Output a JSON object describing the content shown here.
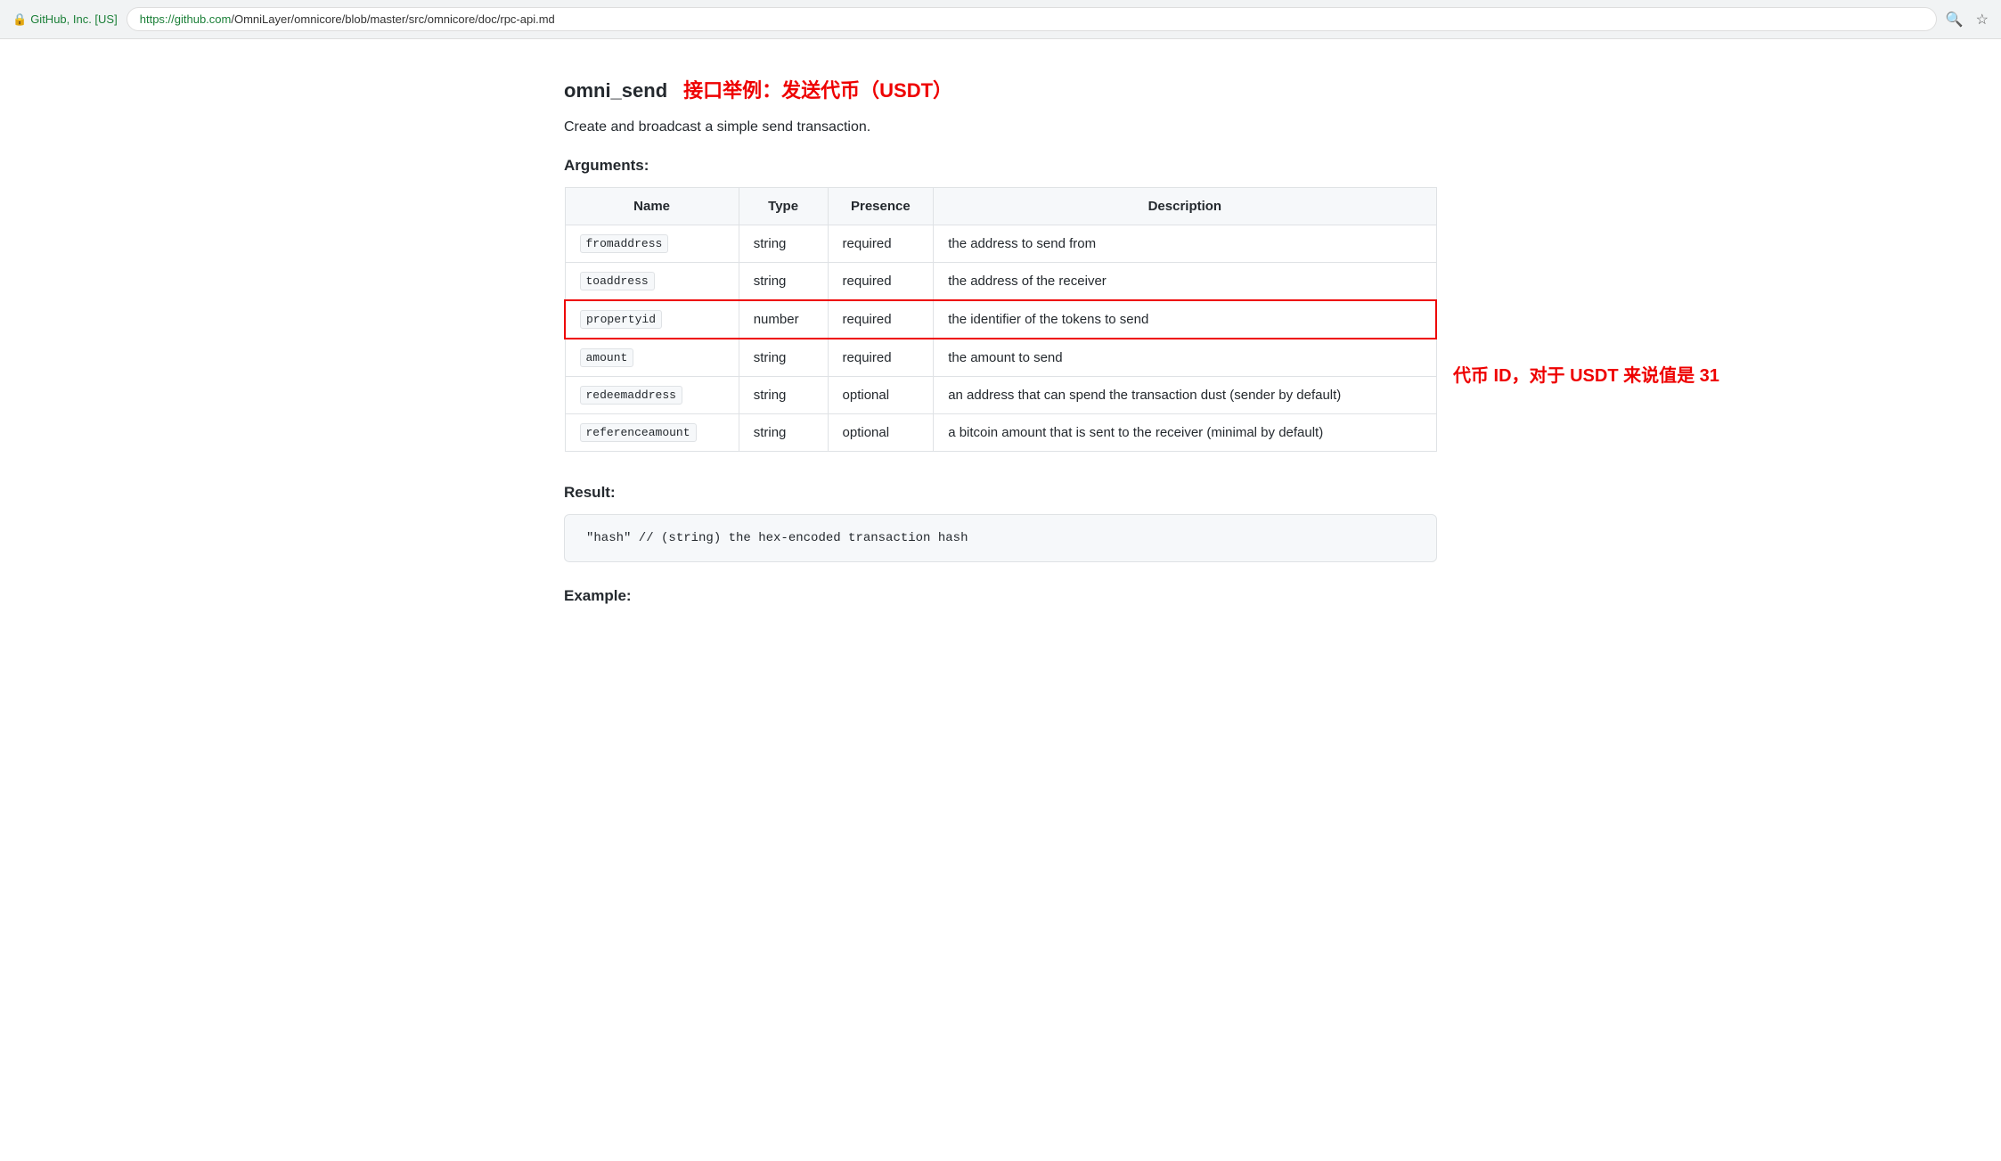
{
  "browser": {
    "security_label": "GitHub, Inc. [US]",
    "url_green": "https://github.com",
    "url_dark": "/OmniLayer/omnicore/blob/master/src/omnicore/doc/rpc-api.md",
    "lock_icon": "🔒",
    "search_icon": "🔍",
    "star_icon": "☆"
  },
  "page": {
    "title": "omni_send",
    "subtitle": "接口举例：发送代币（USDT）",
    "description": "Create and broadcast a simple send transaction.",
    "arguments_heading": "Arguments:",
    "result_heading": "Result:",
    "example_heading": "Example:"
  },
  "table": {
    "headers": [
      {
        "label": "Name",
        "align": "center"
      },
      {
        "label": "Type",
        "align": "center"
      },
      {
        "label": "Presence",
        "align": "center"
      },
      {
        "label": "Description",
        "align": "center"
      }
    ],
    "rows": [
      {
        "name": "fromaddress",
        "type": "string",
        "presence": "required",
        "description": "the address to send from",
        "highlighted": false
      },
      {
        "name": "toaddress",
        "type": "string",
        "presence": "required",
        "description": "the address of the receiver",
        "highlighted": false
      },
      {
        "name": "propertyid",
        "type": "number",
        "presence": "required",
        "description": "the identifier of the tokens to send",
        "highlighted": true,
        "annotation": "代币 ID，对于 USDT 来说值是 31"
      },
      {
        "name": "amount",
        "type": "string",
        "presence": "required",
        "description": "the amount to send",
        "highlighted": false
      },
      {
        "name": "redeemaddress",
        "type": "string",
        "presence": "optional",
        "description": "an address that can spend the transaction dust (sender by default)",
        "highlighted": false
      },
      {
        "name": "referenceamount",
        "type": "string",
        "presence": "optional",
        "description": "a bitcoin amount that is sent to the receiver (minimal by default)",
        "highlighted": false
      }
    ]
  },
  "result_code": "\"hash\"  // (string) the hex-encoded transaction hash",
  "colors": {
    "highlight_border": "#e00",
    "code_bg": "#f6f8fa",
    "table_border": "#dfe2e5",
    "annotation_color": "#e00"
  }
}
